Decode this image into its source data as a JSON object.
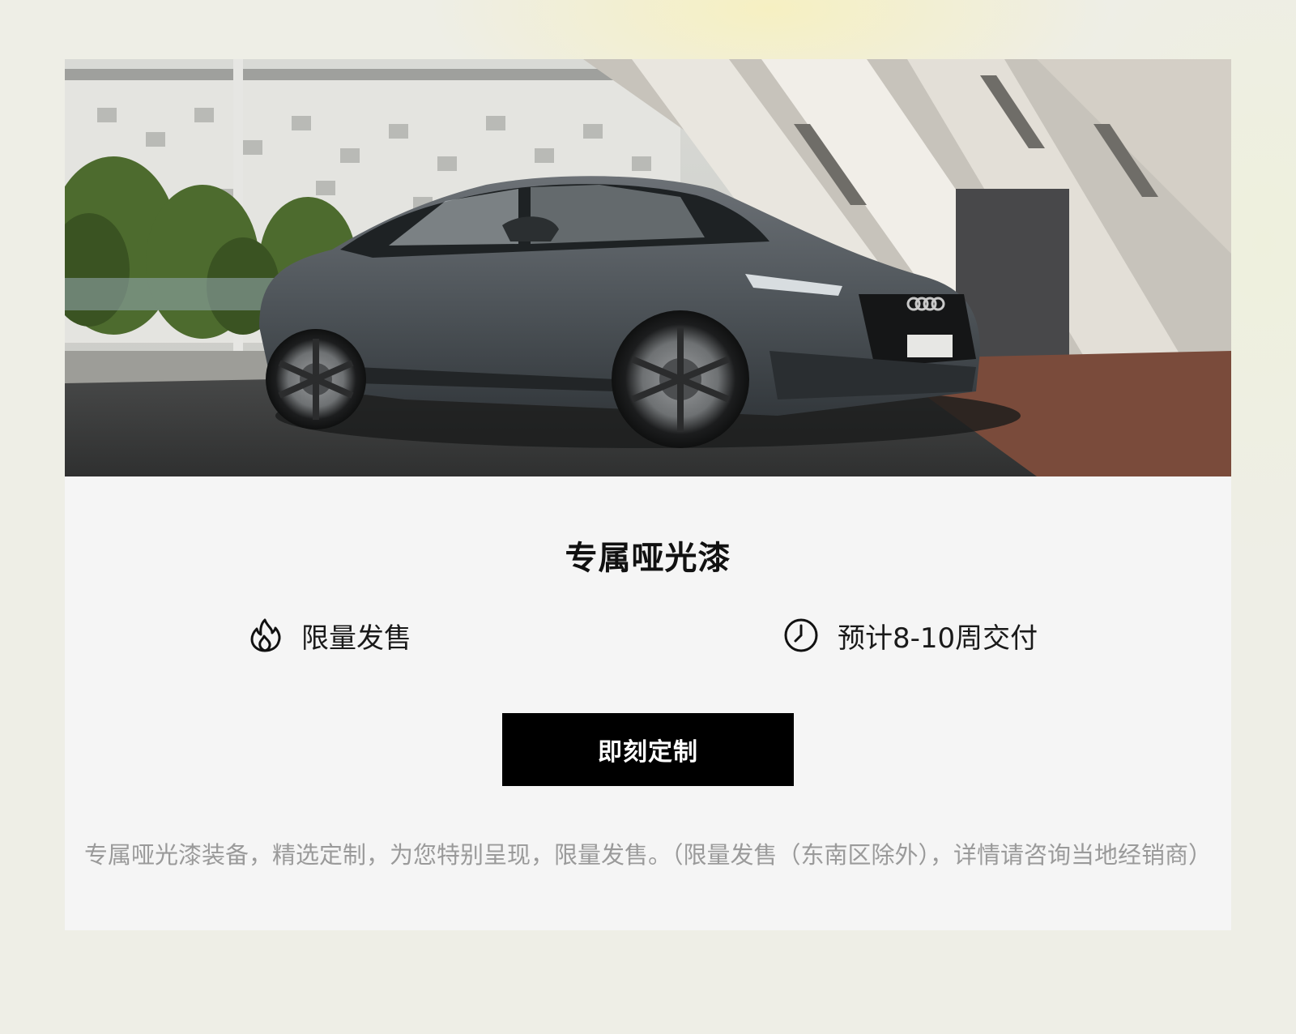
{
  "card": {
    "hero_image": "car-photo",
    "title": "专属哑光漆",
    "features": [
      {
        "icon": "flame-icon",
        "label": "限量发售"
      },
      {
        "icon": "clock-icon",
        "label": "预计8-10周交付"
      }
    ],
    "cta_label": "即刻定制",
    "description": "专属哑光漆装备，精选定制，为您特别呈现，限量发售。（限量发售（东南区除外），详情请咨询当地经销商）"
  },
  "colors": {
    "page_background": "#eeeee6",
    "card_background": "#f5f5f5",
    "button_background": "#000000",
    "button_text": "#ffffff",
    "description_text": "#9a9a9a"
  }
}
